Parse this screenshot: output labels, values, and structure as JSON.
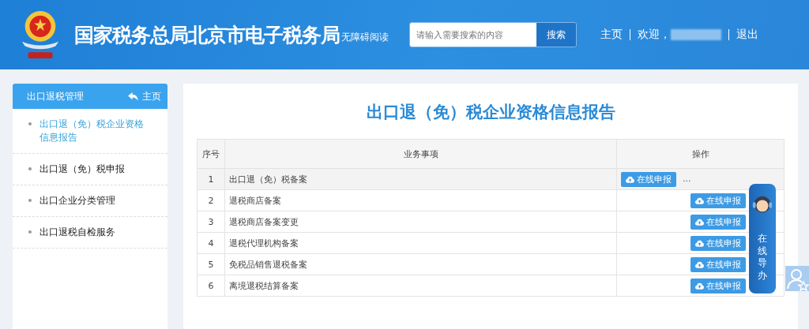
{
  "header": {
    "site_title": "国家税务总局北京市电子税务局",
    "accessibility_link": "无障碍阅读",
    "search": {
      "placeholder": "请输入需要搜索的内容",
      "button": "搜索"
    },
    "nav": {
      "home": "主页",
      "welcome": "欢迎，",
      "logout": "退出"
    }
  },
  "sidebar": {
    "title": "出口退税管理",
    "home_link": "主页",
    "items": [
      {
        "label": "出口退（免）税企业资格信息报告",
        "selected": true
      },
      {
        "label": "出口退（免）税申报",
        "selected": false
      },
      {
        "label": "出口企业分类管理",
        "selected": false
      },
      {
        "label": "出口退税自检服务",
        "selected": false
      }
    ]
  },
  "page_title": "出口退（免）税企业资格信息报告",
  "table": {
    "columns": [
      "序号",
      "业务事项",
      "操作"
    ],
    "rows": [
      {
        "index": "1",
        "item": "出口退（免）税备案",
        "action": "在线申报",
        "highlighted": true,
        "more": "..."
      },
      {
        "index": "2",
        "item": "退税商店备案",
        "action": "在线申报",
        "highlighted": false
      },
      {
        "index": "3",
        "item": "退税商店备案变更",
        "action": "在线申报",
        "highlighted": false
      },
      {
        "index": "4",
        "item": "退税代理机构备案",
        "action": "在线申报",
        "highlighted": false
      },
      {
        "index": "5",
        "item": "免税品销售退税备案",
        "action": "在线申报",
        "highlighted": false
      },
      {
        "index": "6",
        "item": "离境退税结算备案",
        "action": "在线申报",
        "highlighted": false
      }
    ]
  },
  "guide_widget": {
    "label": "在线导办"
  }
}
